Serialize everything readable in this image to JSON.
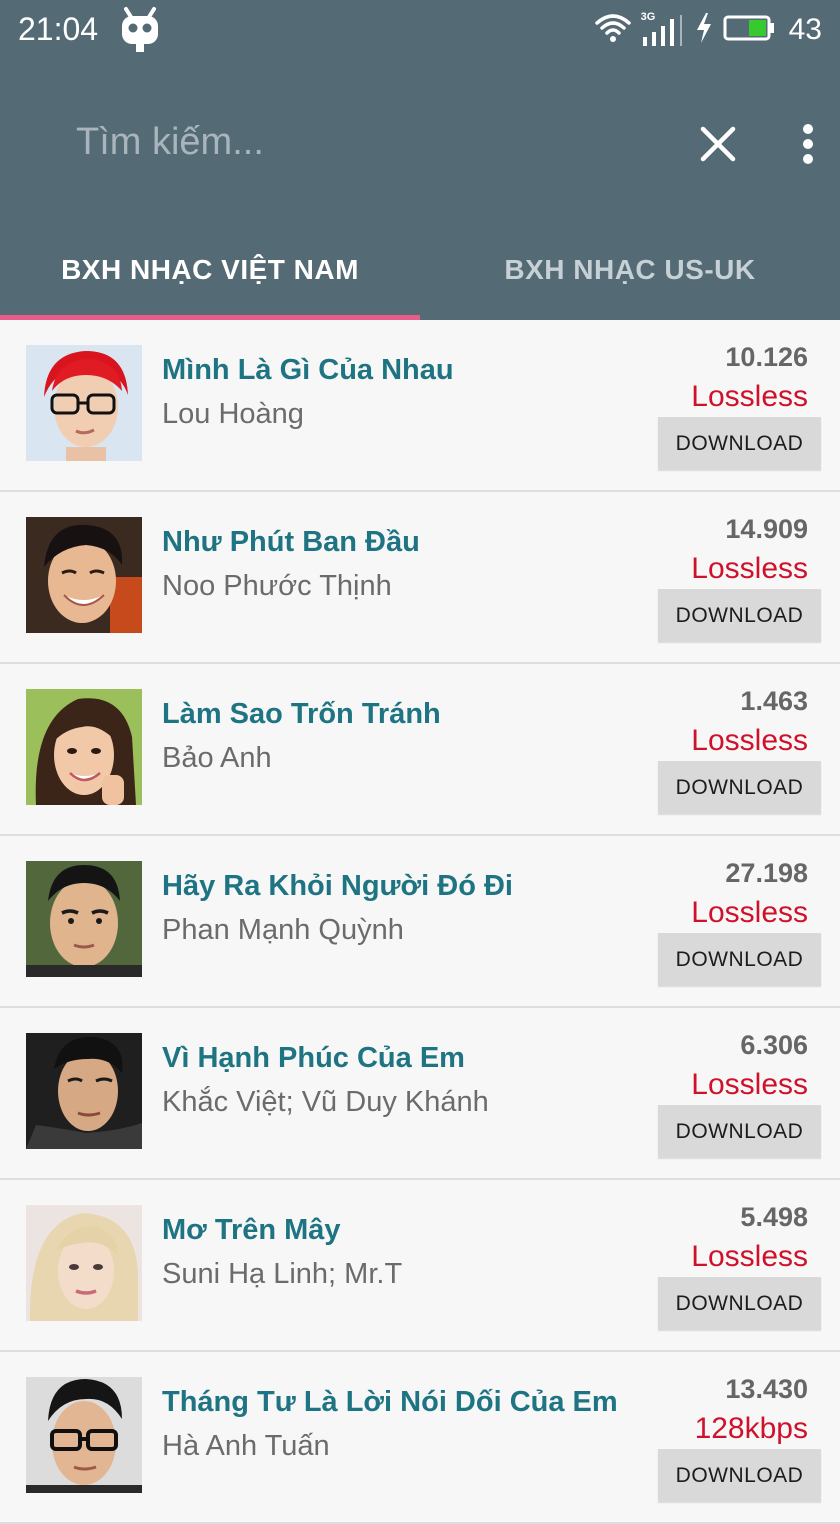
{
  "status_bar": {
    "time": "21:04",
    "battery_level": "43",
    "network_type": "3G",
    "icons": [
      "cyanogen-robot-icon",
      "wifi-icon",
      "signal-icon",
      "charging-icon",
      "battery-icon"
    ]
  },
  "search": {
    "placeholder": "Tìm kiếm...",
    "value": ""
  },
  "tabs": [
    {
      "label": "BXH NHẠC VIỆT NAM",
      "active": true
    },
    {
      "label": "BXH NHẠC US-UK",
      "active": false
    }
  ],
  "colors": {
    "toolbar": "#546a75",
    "tab_indicator": "#e85c8a",
    "title": "#1e7482",
    "quality": "#d0112b",
    "download_button": "#d9d9d9"
  },
  "download_label": "DOWNLOAD",
  "songs": [
    {
      "title": "Mình Là Gì Của Nhau",
      "artist": "Lou Hoàng",
      "count": "10.126",
      "quality": "Lossless"
    },
    {
      "title": "Như Phút Ban Đầu",
      "artist": "Noo Phước Thịnh",
      "count": "14.909",
      "quality": "Lossless"
    },
    {
      "title": "Làm Sao Trốn Tránh",
      "artist": "Bảo Anh",
      "count": "1.463",
      "quality": "Lossless"
    },
    {
      "title": "Hãy Ra Khỏi Người Đó Đi",
      "artist": "Phan Mạnh Quỳnh",
      "count": "27.198",
      "quality": "Lossless"
    },
    {
      "title": "Vì Hạnh Phúc Của Em",
      "artist": "Khắc Việt; Vũ Duy Khánh",
      "count": "6.306",
      "quality": "Lossless"
    },
    {
      "title": "Mơ Trên Mây",
      "artist": "Suni Hạ Linh; Mr.T",
      "count": "5.498",
      "quality": "Lossless"
    },
    {
      "title": "Tháng Tư Là Lời Nói Dối Của Em",
      "artist": "Hà Anh Tuấn",
      "count": "13.430",
      "quality": "128kbps"
    }
  ]
}
